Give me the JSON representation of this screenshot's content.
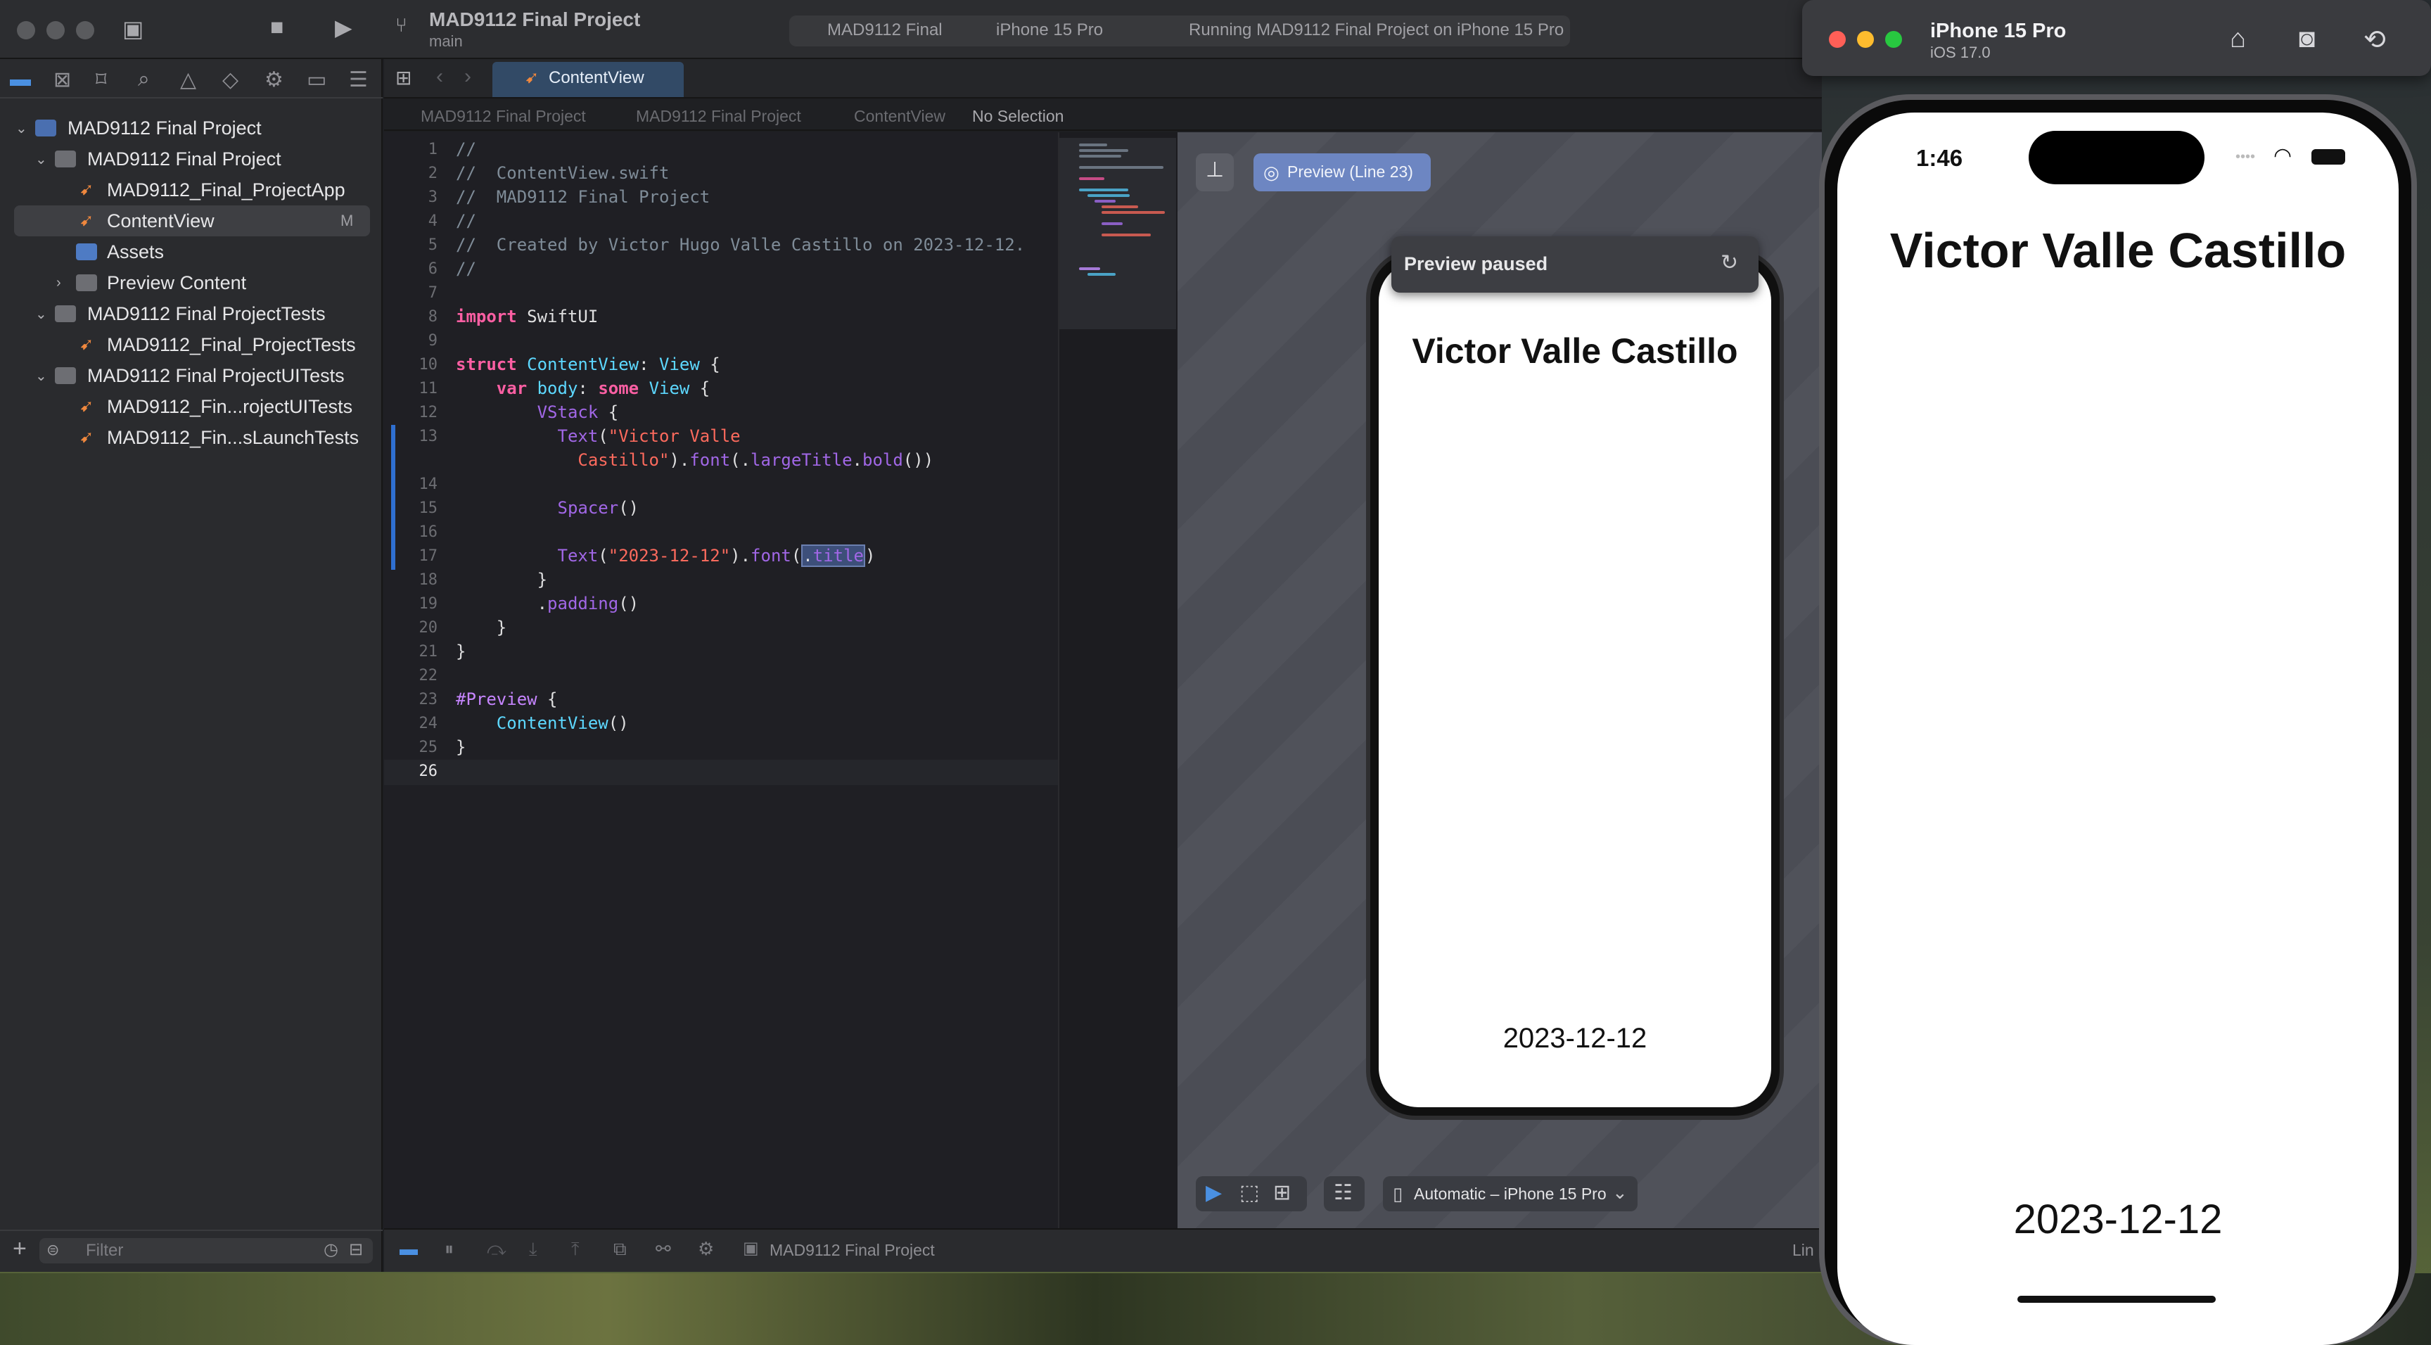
{
  "xcode": {
    "project_title": "MAD9112 Final Project",
    "branch": "main",
    "scheme": "MAD9112 Final",
    "destination": "iPhone 15 Pro",
    "run_status": "Running MAD9112 Final Project on iPhone 15 Pro"
  },
  "navigator": {
    "items": [
      {
        "label": "MAD9112 Final Project"
      },
      {
        "label": "MAD9112 Final Project"
      },
      {
        "label": "MAD9112_Final_ProjectApp"
      },
      {
        "label": "ContentView",
        "badge": "M"
      },
      {
        "label": "Assets"
      },
      {
        "label": "Preview Content"
      },
      {
        "label": "MAD9112 Final ProjectTests"
      },
      {
        "label": "MAD9112_Final_ProjectTests"
      },
      {
        "label": "MAD9112 Final ProjectUITests"
      },
      {
        "label": "MAD9112_Fin...rojectUITests"
      },
      {
        "label": "MAD9112_Fin...sLaunchTests"
      }
    ],
    "filter_placeholder": "Filter"
  },
  "editor": {
    "tab_label": "ContentView",
    "breadcrumb": [
      "MAD9112 Final Project",
      "MAD9112 Final Project",
      "ContentView",
      "No Selection"
    ],
    "line_numbers": [
      "1",
      "2",
      "3",
      "4",
      "5",
      "6",
      "7",
      "8",
      "9",
      "10",
      "11",
      "12",
      "13",
      "",
      "14",
      "15",
      "16",
      "17",
      "18",
      "19",
      "20",
      "21",
      "22",
      "23",
      "24",
      "25",
      "26"
    ]
  },
  "canvas": {
    "preview_badge": "Preview (Line 23)",
    "paused_text": "Preview paused",
    "preview_title": "Victor Valle Castillo",
    "preview_date": "2023-12-12",
    "device_picker": "Automatic – iPhone 15 Pro"
  },
  "statusbar": {
    "project": "MAD9112 Final Project",
    "line_fragment": "Lin"
  },
  "simulator": {
    "device_name": "iPhone 15 Pro",
    "os_version": "iOS 17.0",
    "time": "1:46",
    "title": "Victor Valle Castillo",
    "date": "2023-12-12"
  },
  "colors": {
    "accent": "#2f6fd0",
    "keyword": "#fc5fa3",
    "string": "#fc6a5d",
    "type": "#5dd8ff"
  }
}
